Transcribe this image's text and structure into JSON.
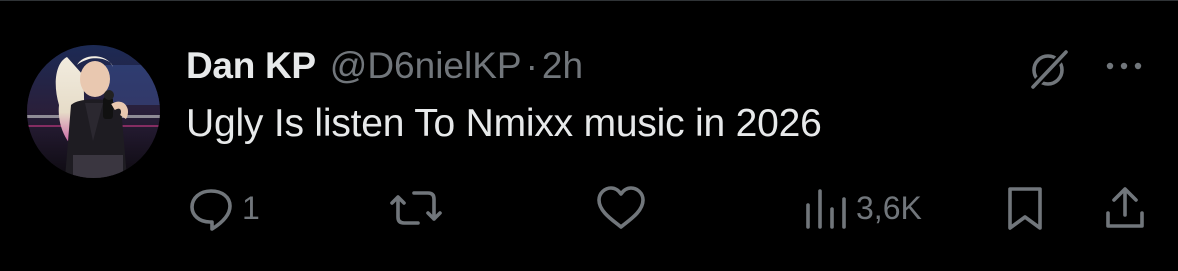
{
  "tweet": {
    "display_name": "Dan KP",
    "handle": "@D6nielKP",
    "separator": "·",
    "time": "2h",
    "text": "Ugly Is listen To Nmixx music in 2026"
  },
  "actions": {
    "reply": {
      "icon": "reply-icon",
      "count": "1"
    },
    "retweet": {
      "icon": "retweet-icon",
      "count": ""
    },
    "like": {
      "icon": "heart-icon",
      "count": ""
    },
    "views": {
      "icon": "views-icon",
      "count": "3,6K"
    },
    "bookmark": {
      "icon": "bookmark-icon"
    },
    "share": {
      "icon": "share-icon"
    }
  },
  "header_icons": [
    "grok-icon",
    "more-icon"
  ],
  "colors": {
    "background": "#000000",
    "primary_text": "#e7e9ea",
    "secondary_text": "#71767b",
    "divider": "#2f3336"
  }
}
